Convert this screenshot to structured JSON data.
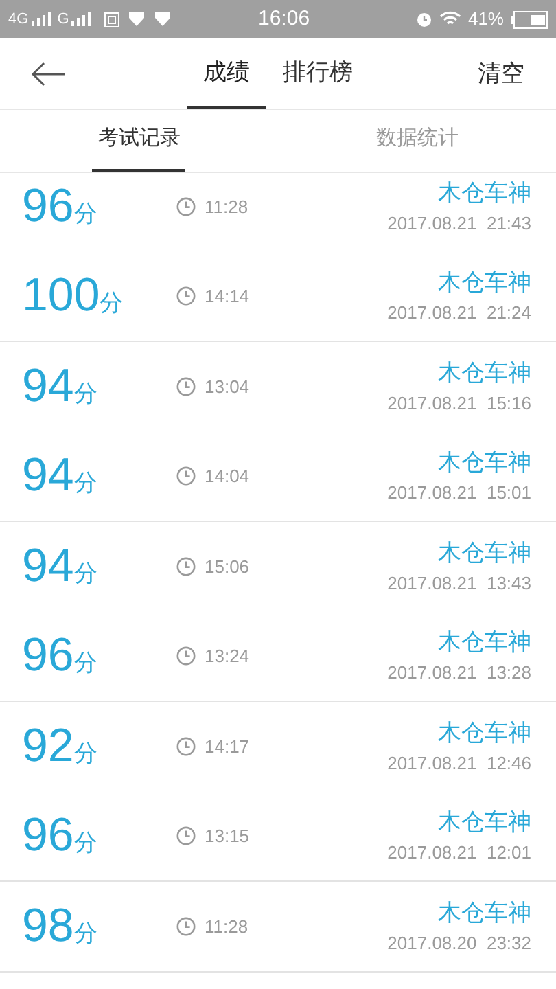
{
  "status_bar": {
    "network_1": "4G",
    "network_2": "G",
    "time": "16:06",
    "battery": "41%"
  },
  "header": {
    "tabs": [
      {
        "label": "成绩",
        "selected": true
      },
      {
        "label": "排行榜",
        "selected": false
      }
    ],
    "action": "清空"
  },
  "sub_tabs": [
    {
      "label": "考试记录",
      "selected": true
    },
    {
      "label": "数据统计",
      "selected": false
    }
  ],
  "groups": [
    [
      {
        "score": "96",
        "unit": "分",
        "duration": "11:28",
        "name": "木仓车神",
        "date": "2017.08.21  21:43"
      },
      {
        "score": "100",
        "unit": "分",
        "duration": "14:14",
        "name": "木仓车神",
        "date": "2017.08.21  21:24"
      }
    ],
    [
      {
        "score": "94",
        "unit": "分",
        "duration": "13:04",
        "name": "木仓车神",
        "date": "2017.08.21  15:16"
      },
      {
        "score": "94",
        "unit": "分",
        "duration": "14:04",
        "name": "木仓车神",
        "date": "2017.08.21  15:01"
      }
    ],
    [
      {
        "score": "94",
        "unit": "分",
        "duration": "15:06",
        "name": "木仓车神",
        "date": "2017.08.21  13:43"
      },
      {
        "score": "96",
        "unit": "分",
        "duration": "13:24",
        "name": "木仓车神",
        "date": "2017.08.21  13:28"
      }
    ],
    [
      {
        "score": "92",
        "unit": "分",
        "duration": "14:17",
        "name": "木仓车神",
        "date": "2017.08.21  12:46"
      },
      {
        "score": "96",
        "unit": "分",
        "duration": "13:15",
        "name": "木仓车神",
        "date": "2017.08.21  12:01"
      }
    ],
    [
      {
        "score": "98",
        "unit": "分",
        "duration": "11:28",
        "name": "木仓车神",
        "date": "2017.08.20  23:32"
      }
    ]
  ]
}
